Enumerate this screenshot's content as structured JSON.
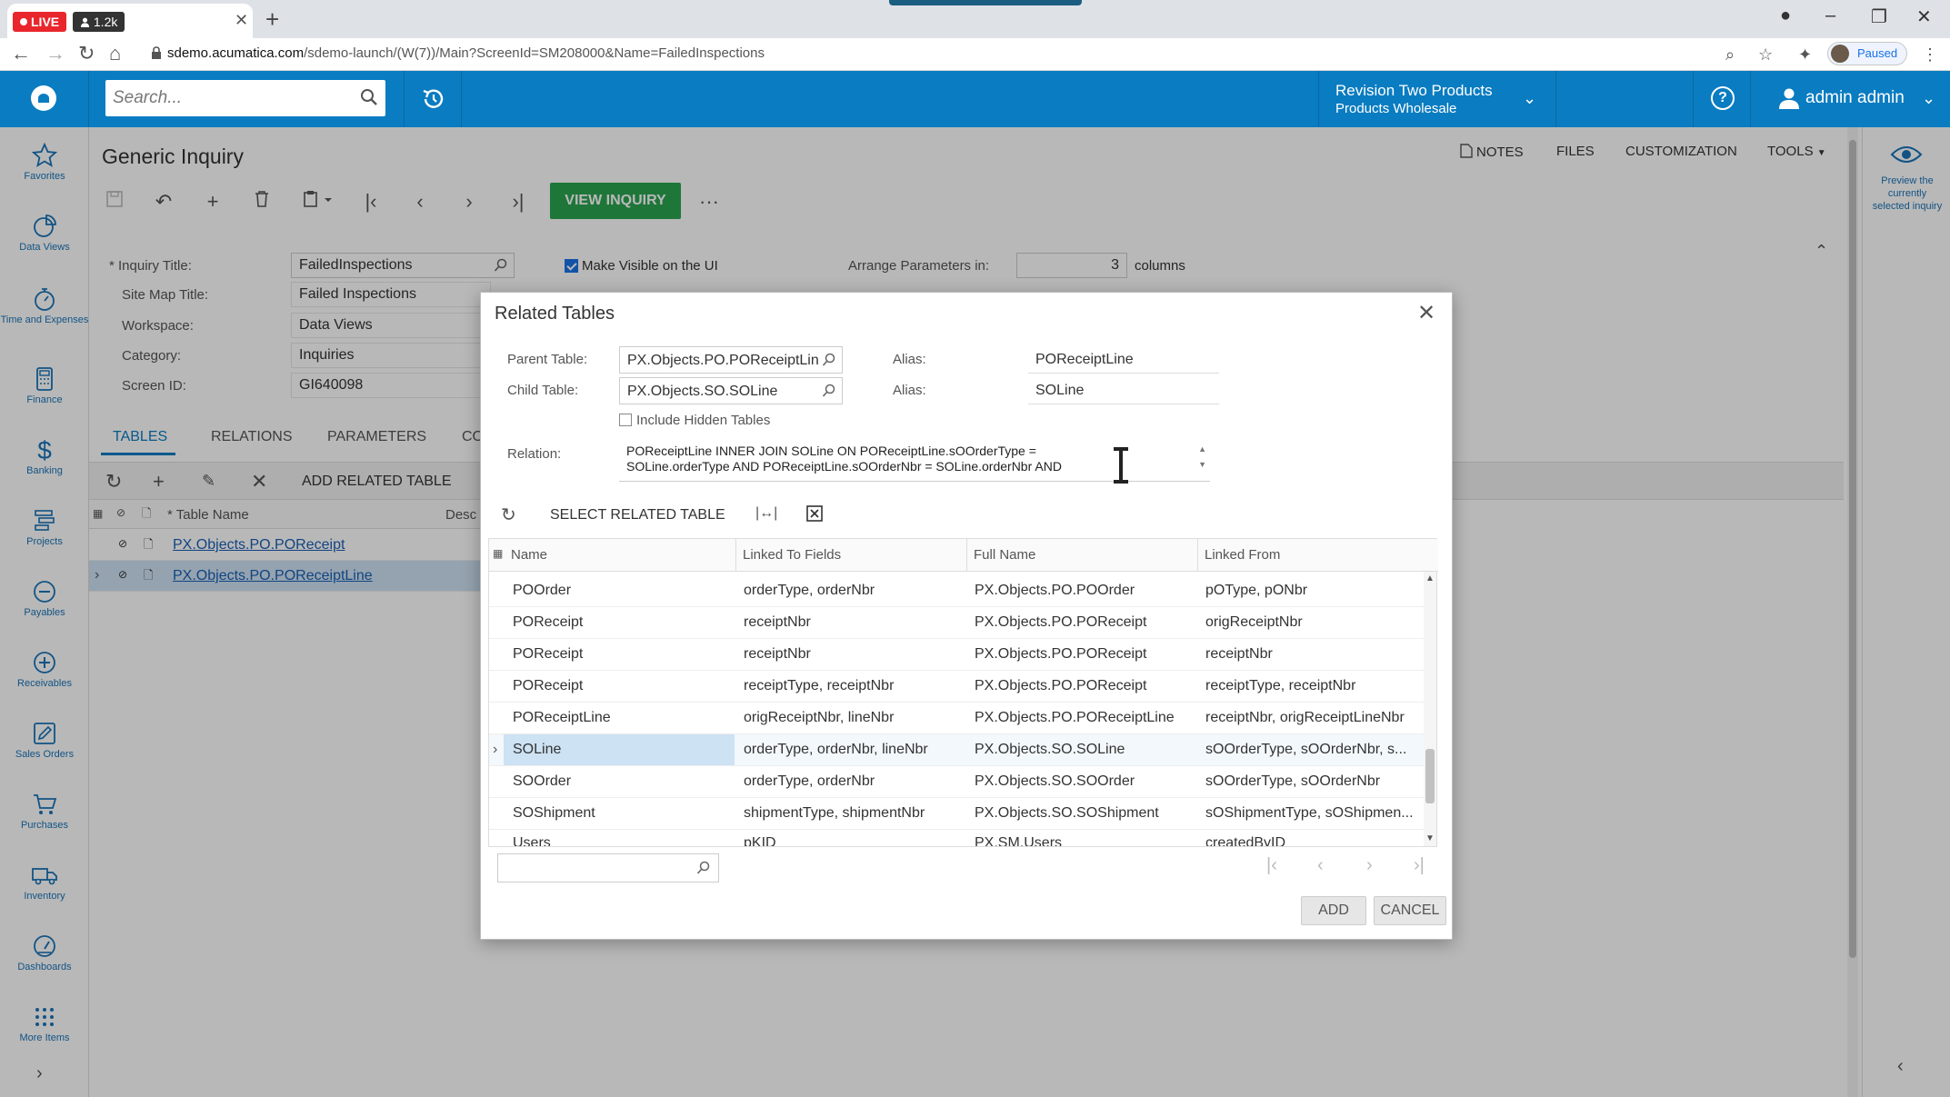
{
  "browser": {
    "live_label": "LIVE",
    "viewers": "1.2k",
    "url_host": "sdemo.acumatica.com",
    "url_path": "/sdemo-launch/(W(7))/Main?ScreenId=SM208000&Name=FailedInspections",
    "paused_label": "Paused"
  },
  "header": {
    "search_placeholder": "Search...",
    "company_name": "Revision Two Products",
    "company_branch": "Products Wholesale",
    "user_name": "admin admin"
  },
  "leftnav": {
    "items": [
      {
        "label": "Favorites",
        "icon": "star-icon"
      },
      {
        "label": "Data Views",
        "icon": "pie-chart-icon"
      },
      {
        "label": "Time and Expenses",
        "icon": "stopwatch-icon"
      },
      {
        "label": "Finance",
        "icon": "calculator-icon"
      },
      {
        "label": "Banking",
        "icon": "dollar-icon"
      },
      {
        "label": "Projects",
        "icon": "projects-icon"
      },
      {
        "label": "Payables",
        "icon": "minus-circle-icon"
      },
      {
        "label": "Receivables",
        "icon": "plus-circle-icon"
      },
      {
        "label": "Sales Orders",
        "icon": "edit-box-icon"
      },
      {
        "label": "Purchases",
        "icon": "cart-icon"
      },
      {
        "label": "Inventory",
        "icon": "truck-icon"
      },
      {
        "label": "Dashboards",
        "icon": "gauge-icon"
      },
      {
        "label": "More Items",
        "icon": "grid-dots-icon"
      }
    ]
  },
  "page": {
    "title": "Generic Inquiry",
    "links": {
      "notes": "NOTES",
      "files": "FILES",
      "customization": "CUSTOMIZATION",
      "tools": "TOOLS"
    },
    "view_inquiry": "VIEW INQUIRY"
  },
  "form": {
    "inquiry_title_label": "Inquiry Title:",
    "inquiry_title": "FailedInspections",
    "site_map_title_label": "Site Map Title:",
    "site_map_title": "Failed Inspections",
    "workspace_label": "Workspace:",
    "workspace": "Data Views",
    "category_label": "Category:",
    "category": "Inquiries",
    "screen_id_label": "Screen ID:",
    "screen_id": "GI640098",
    "make_visible_label": "Make Visible on the UI",
    "arrange_label": "Arrange Parameters in:",
    "arrange_value": "3",
    "columns_label": "columns"
  },
  "tabs": {
    "tables": "TABLES",
    "relations": "RELATIONS",
    "parameters": "PARAMETERS",
    "co": "CO"
  },
  "tables_grid": {
    "add_related": "ADD RELATED TABLE",
    "col_table_name": "Table Name",
    "col_desc": "Desc",
    "rows": [
      "PX.Objects.PO.POReceipt",
      "PX.Objects.PO.POReceiptLine"
    ]
  },
  "right_panel": {
    "label": "Preview the currently selected inquiry"
  },
  "dialog": {
    "title": "Related Tables",
    "parent_table_label": "Parent Table:",
    "parent_table": "PX.Objects.PO.POReceiptLin",
    "parent_alias_label": "Alias:",
    "parent_alias": "POReceiptLine",
    "child_table_label": "Child Table:",
    "child_table": "PX.Objects.SO.SOLine",
    "child_alias_label": "Alias:",
    "child_alias": "SOLine",
    "include_hidden": "Include Hidden Tables",
    "relation_label": "Relation:",
    "relation_line1": "POReceiptLine INNER JOIN SOLine ON POReceiptLine.sOOrderType =",
    "relation_line2": "SOLine.orderType AND POReceiptLine.sOOrderNbr = SOLine.orderNbr AND",
    "select_related": "SELECT RELATED TABLE",
    "columns": {
      "name": "Name",
      "linked_to": "Linked To Fields",
      "full_name": "Full Name",
      "linked_from": "Linked From"
    },
    "rows": [
      {
        "name": "POOrder",
        "linked_to": "orderType, orderNbr",
        "full_name": "PX.Objects.PO.POOrder",
        "linked_from": "pOType, pONbr"
      },
      {
        "name": "POReceipt",
        "linked_to": "receiptNbr",
        "full_name": "PX.Objects.PO.POReceipt",
        "linked_from": "origReceiptNbr"
      },
      {
        "name": "POReceipt",
        "linked_to": "receiptNbr",
        "full_name": "PX.Objects.PO.POReceipt",
        "linked_from": "receiptNbr"
      },
      {
        "name": "POReceipt",
        "linked_to": "receiptType, receiptNbr",
        "full_name": "PX.Objects.PO.POReceipt",
        "linked_from": "receiptType, receiptNbr"
      },
      {
        "name": "POReceiptLine",
        "linked_to": "origReceiptNbr, lineNbr",
        "full_name": "PX.Objects.PO.POReceiptLine",
        "linked_from": "receiptNbr, origReceiptLineNbr"
      },
      {
        "name": "SOLine",
        "linked_to": "orderType, orderNbr, lineNbr",
        "full_name": "PX.Objects.SO.SOLine",
        "linked_from": "sOOrderType, sOOrderNbr, s..."
      },
      {
        "name": "SOOrder",
        "linked_to": "orderType, orderNbr",
        "full_name": "PX.Objects.SO.SOOrder",
        "linked_from": "sOOrderType, sOOrderNbr"
      },
      {
        "name": "SOShipment",
        "linked_to": "shipmentType, shipmentNbr",
        "full_name": "PX.Objects.SO.SOShipment",
        "linked_from": "sOShipmentType, sOShipmen..."
      },
      {
        "name": "Users",
        "linked_to": "pKID",
        "full_name": "PX.SM.Users",
        "linked_from": "createdByID"
      }
    ],
    "add": "ADD",
    "cancel": "CANCEL"
  }
}
